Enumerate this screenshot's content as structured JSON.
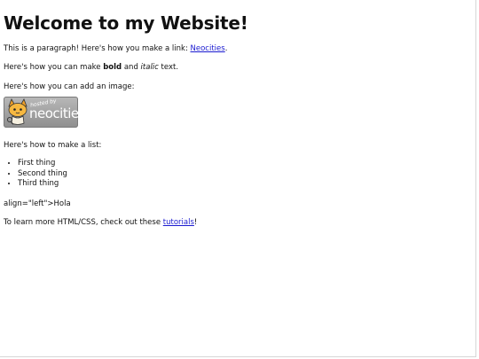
{
  "page": {
    "heading": "Welcome to my Website!",
    "para1": {
      "text": "This is a paragraph! Here's how you make a link: ",
      "link": "Neocities",
      "end": "."
    },
    "para2": {
      "pre": "Here's how you can make ",
      "bold": "bold",
      "mid": " and ",
      "italic": "italic",
      "post": " text."
    },
    "para3": "Here's how you can add an image:",
    "badge": {
      "small": "hosted by",
      "brand": "neocities",
      "icon": "neocities-cat-icon"
    },
    "para4": "Here's how to make a list:",
    "list": [
      "First thing",
      "Second thing",
      "Third thing"
    ],
    "para5": "align=\"left\">Hola",
    "para6": {
      "pre": "To learn more HTML/CSS, check out these ",
      "link": "tutorials",
      "end": "!"
    }
  },
  "colors": {
    "link": "#1a1ad0",
    "text": "#111111",
    "background": "#ffffff"
  }
}
